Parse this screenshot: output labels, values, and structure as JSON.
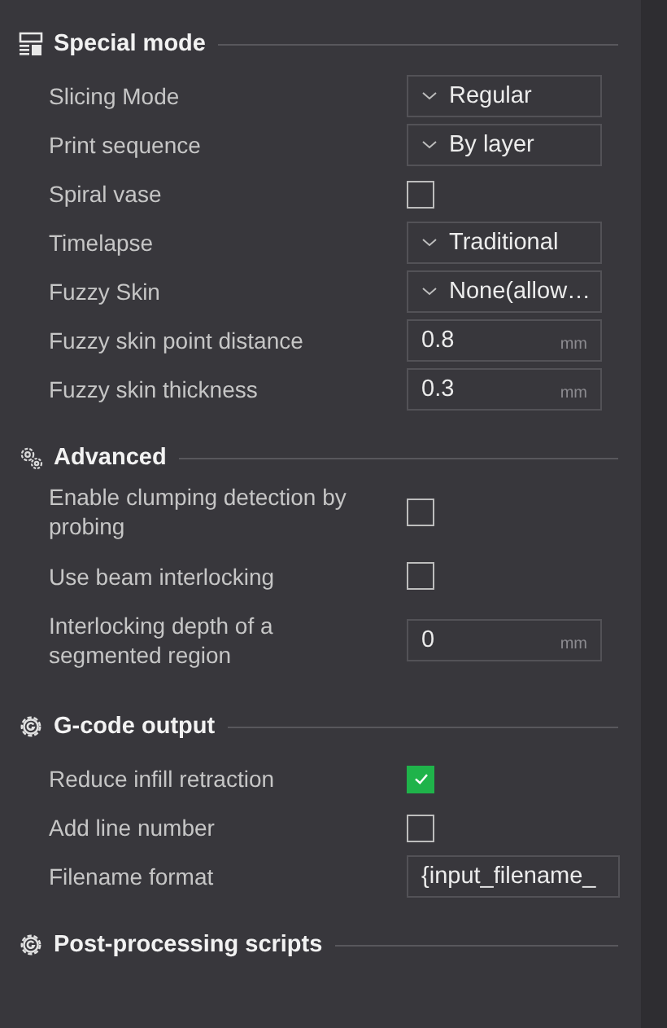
{
  "sections": [
    {
      "title": "Special mode",
      "rows": [
        {
          "label": "Slicing Mode",
          "kind": "dropdown",
          "value": "Regular"
        },
        {
          "label": "Print sequence",
          "kind": "dropdown",
          "value": "By layer"
        },
        {
          "label": "Spiral vase",
          "kind": "checkbox",
          "checked": false
        },
        {
          "label": "Timelapse",
          "kind": "dropdown",
          "value": "Traditional"
        },
        {
          "label": "Fuzzy Skin",
          "kind": "dropdown",
          "value": "None(allow…"
        },
        {
          "label": "Fuzzy skin point distance",
          "kind": "number",
          "value": "0.8",
          "unit": "mm"
        },
        {
          "label": "Fuzzy skin thickness",
          "kind": "number",
          "value": "0.3",
          "unit": "mm"
        }
      ]
    },
    {
      "title": "Advanced",
      "rows": [
        {
          "label": "Enable clumping detection by probing",
          "kind": "checkbox",
          "checked": false
        },
        {
          "label": "Use beam interlocking",
          "kind": "checkbox",
          "checked": false
        },
        {
          "label": "Interlocking depth of a segmented region",
          "kind": "number",
          "value": "0",
          "unit": "mm"
        }
      ]
    },
    {
      "title": "G-code output",
      "rows": [
        {
          "label": "Reduce infill retraction",
          "kind": "checkbox",
          "checked": true
        },
        {
          "label": "Add line number",
          "kind": "checkbox",
          "checked": false
        },
        {
          "label": "Filename format",
          "kind": "text",
          "value": "{input_filename_"
        }
      ]
    },
    {
      "title": "Post-processing scripts"
    }
  ]
}
